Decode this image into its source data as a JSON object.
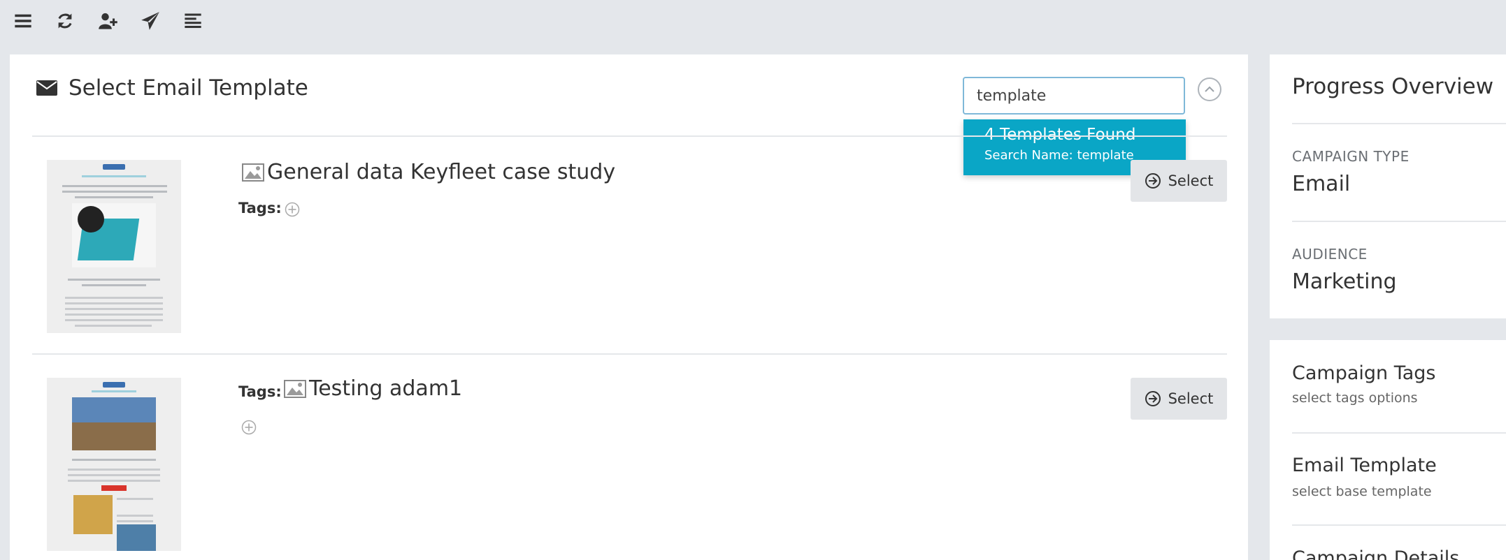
{
  "toolbar": {
    "icons": [
      "menu-icon",
      "refresh-icon",
      "add-user-icon",
      "send-icon",
      "list-icon"
    ]
  },
  "main": {
    "title": "Select Email Template",
    "search": {
      "value": "template"
    },
    "dropdown": {
      "count_text": "4 Templates Found",
      "search_text": "Search Name: template"
    },
    "templates": [
      {
        "name": "General data Keyfleet case study",
        "tags_label": "Tags:",
        "select_label": "Select"
      },
      {
        "name": "Testing adam1",
        "tags_label": "Tags:",
        "select_label": "Select"
      }
    ]
  },
  "progress": {
    "title": "Progress Overview",
    "campaign_type_label": "CAMPAIGN TYPE",
    "campaign_type_value": "Email",
    "audience_label": "AUDIENCE",
    "audience_value": "Marketing"
  },
  "steps": [
    {
      "title": "Campaign Tags",
      "subtitle": "select tags options"
    },
    {
      "title": "Email Template",
      "subtitle": "select base template"
    },
    {
      "title": "Campaign Details",
      "subtitle": ""
    }
  ],
  "colors": {
    "accent": "#0aa6c6",
    "background": "#e4e7eb",
    "button_bg": "#e3e5e8"
  }
}
